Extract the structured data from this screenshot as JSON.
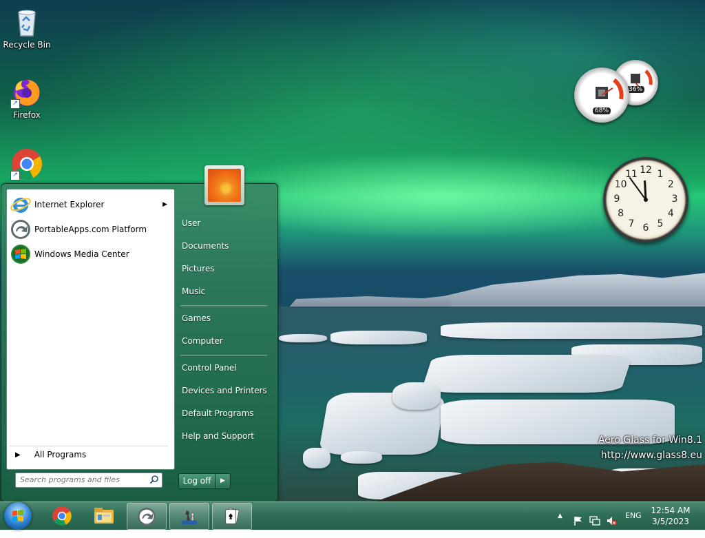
{
  "desktop": {
    "icons": [
      {
        "label": "Recycle Bin",
        "icon": "recycle-bin-icon"
      },
      {
        "label": "Firefox",
        "icon": "firefox-icon"
      },
      {
        "label": "",
        "icon": "chrome-icon"
      }
    ],
    "watermark": {
      "line1": "Aero Glass for Win8.1",
      "line2": "http://www.glass8.eu"
    }
  },
  "gadgets": {
    "cpu_meter": {
      "cpu": "68%",
      "memory": "36%",
      "cpu_value": 68,
      "memory_value": 36
    },
    "clock": {
      "hour": 11,
      "minute": 54,
      "numerals": [
        "12",
        "1",
        "2",
        "3",
        "4",
        "5",
        "6",
        "7",
        "8",
        "9",
        "10",
        "11"
      ]
    }
  },
  "start_menu": {
    "pinned": [
      {
        "label": "Internet Explorer",
        "icon": "internet-explorer-icon",
        "has_submenu": true
      },
      {
        "label": "PortableApps.com Platform",
        "icon": "portableapps-icon",
        "has_submenu": false
      },
      {
        "label": "Windows Media Center",
        "icon": "windows-media-center-icon",
        "has_submenu": false
      }
    ],
    "all_programs": "All Programs",
    "search_placeholder": "Search programs and files",
    "right_items": [
      "User",
      "Documents",
      "Pictures",
      "Music",
      "Games",
      "Computer",
      "Control Panel",
      "Devices and Printers",
      "Default Programs",
      "Help and Support"
    ],
    "log_off": "Log off"
  },
  "taskbar": {
    "buttons": [
      {
        "icon": "chrome-icon",
        "open": false
      },
      {
        "icon": "file-explorer-icon",
        "open": false
      },
      {
        "icon": "portableapps-icon",
        "open": true
      },
      {
        "icon": "chess-icon",
        "open": true
      },
      {
        "icon": "solitaire-icon",
        "open": true
      }
    ],
    "tray": {
      "language": "ENG",
      "time": "12:54 AM",
      "date": "3/5/2023"
    }
  },
  "colors": {
    "accent": "#2f6e56",
    "menu_glass": "#2b7a58"
  }
}
